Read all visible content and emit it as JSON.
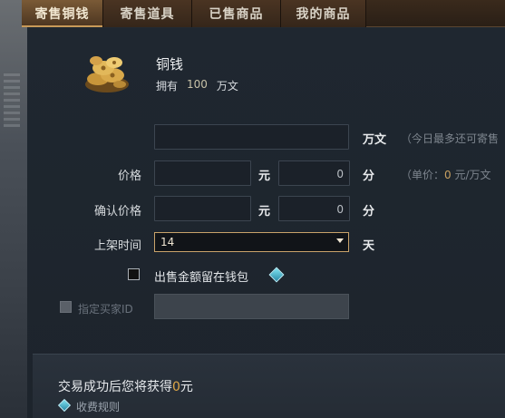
{
  "tabs": [
    {
      "label": "寄售铜钱",
      "active": true
    },
    {
      "label": "寄售道具",
      "active": false
    },
    {
      "label": "已售商品",
      "active": false
    },
    {
      "label": "我的商品",
      "active": false
    }
  ],
  "item": {
    "name": "铜钱",
    "owned_label": "拥有",
    "owned_amount": "100",
    "owned_unit": "万文",
    "icon": "coin-pile-icon"
  },
  "form": {
    "amount": {
      "value": "",
      "unit": "万文",
      "hint": "（今日最多还可寄售"
    },
    "price": {
      "label": "价格",
      "yuan_value": "",
      "yuan_unit": "元",
      "fen_value": "0",
      "fen_unit": "分",
      "hint_prefix": "（单价：",
      "hint_value": "0",
      "hint_suffix": " 元/万文"
    },
    "confirm_price": {
      "label": "确认价格",
      "yuan_value": "",
      "yuan_unit": "元",
      "fen_value": "0",
      "fen_unit": "分"
    },
    "listing_time": {
      "label": "上架时间",
      "value": "14",
      "unit": "天"
    },
    "keep_in_wallet": {
      "label": "出售金额留在钱包",
      "checked": false
    },
    "designate_buyer": {
      "label": "指定买家ID",
      "checked": false,
      "disabled": true,
      "value": ""
    }
  },
  "summary": {
    "gain_prefix": "交易成功后您将获得",
    "gain_value": "0",
    "gain_suffix": "元",
    "rules_label": "收费规则"
  },
  "colors": {
    "accent": "#c9a36a",
    "highlight": "#e0a848",
    "gem": "#5cc8dc"
  }
}
